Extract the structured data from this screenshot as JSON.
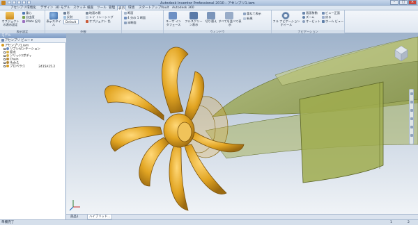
{
  "window": {
    "title": "Autodesk Inventor Professional 2010 - アセンブリ1.iam",
    "controls": [
      "–",
      "□",
      "×"
    ]
  },
  "menu_tabs": [
    {
      "label": "アセンブリ"
    },
    {
      "label": "環境化"
    },
    {
      "label": "デザイン"
    },
    {
      "label": "3D モデル"
    },
    {
      "label": "スケッチ"
    },
    {
      "label": "検査"
    },
    {
      "label": "ツール"
    },
    {
      "label": "管理"
    },
    {
      "label": "表示",
      "active": true
    },
    {
      "label": "環境"
    },
    {
      "label": "スタートアップ"
    },
    {
      "label": "Vault"
    },
    {
      "label": "Autodesk 360"
    }
  ],
  "ribbon": {
    "groups": [
      {
        "label": "表示設定",
        "items": [
          "オブジェクトの表示設定",
          "重心",
          "自由度",
          "iMate 記号"
        ]
      },
      {
        "label": "外観",
        "items": [
          "表示スタイル",
          "影",
          "反射",
          "Default",
          "地面の影",
          "レイ トレーシング",
          "オブジェクト 色"
        ]
      },
      {
        "label": "",
        "items": [
          "断面",
          "4 分の 1 断面",
          "半断面"
        ]
      },
      {
        "label": "ウィンドウ",
        "items": [
          "ユーザ インタフェース",
          "フルスクリーン表示",
          "切り替え",
          "すべてを並べて表示",
          "重ねて表示",
          "新規"
        ]
      },
      {
        "label": "ナビゲーション",
        "items": [
          "フル ナビゲーション ホイール",
          "画面移動",
          "ズーム",
          "オービット",
          "ビュー正面",
          "戻る",
          "ホーム ビュー"
        ]
      }
    ]
  },
  "browser": {
    "title": "モデル",
    "toolbar_label": "アセンブリ ビュー",
    "tree": [
      {
        "label": "アセンブリ1.iam",
        "icon_color": "#d69a1e"
      },
      {
        "label": "リプレゼンテーション",
        "icon_color": "#6a8cc0"
      },
      {
        "label": "原点",
        "icon_color": "#d6b04a"
      },
      {
        "label": "ソリッド/ボディ",
        "icon_color": "#d6b04a"
      },
      {
        "label": "Chain",
        "icon_color": "#b58a38"
      },
      {
        "label": "Hub:1",
        "icon_color": "#b58a38"
      },
      {
        "label": "プロペラ:1",
        "icon_color": "#d69a1e"
      }
    ],
    "tree_suffix": "2415A15.2"
  },
  "doc_tabs": [
    {
      "label": "部品1"
    },
    {
      "label": "ハイブリッド...",
      "active": true
    }
  ],
  "status": {
    "text": "準備完了",
    "left_num": "1",
    "right_num": "2"
  },
  "colors": {
    "propeller": "#e2a523",
    "hull": "#9fab4e",
    "viewport_top": "#9fb3cb"
  }
}
